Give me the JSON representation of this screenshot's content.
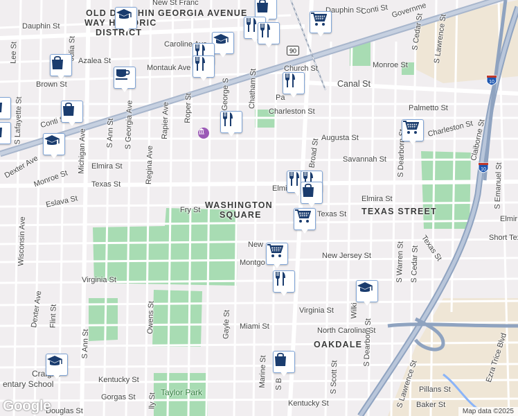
{
  "neighborhoods": {
    "old_dauphin_line1": "OLD DAUPHIN",
    "georgia_avenue": "GEORGIA AVENUE",
    "old_dauphin_line2": "WAY HISTORIC",
    "district": "DISTRICT",
    "washington_square_1": "WASHINGTON",
    "washington_square_2": "SQUARE",
    "texas_street": "TEXAS STREET",
    "oakdale": "OAKDALE"
  },
  "streets": {
    "new_st_francis": "New St Franc",
    "dauphin_st_top": "Dauphin St",
    "dauphin_st_left": "Dauphin St",
    "conti_st_top": "Conti St",
    "government": "Governme",
    "julia_st": "Julia St",
    "lee_st": "Lee St",
    "caroline_ave": "Caroline Ave",
    "azalea_st": "Azalea St",
    "montauk_ave": "Montauk Ave",
    "brown_st": "Brown St",
    "conti_st_left": "Conti St",
    "s_lafayette_st": "S Lafayette St",
    "michigan_ave": "Michigan Ave",
    "s_ann_st": "S Ann St",
    "s_georgia_ave": "S Georgia Ave",
    "rapier_ave": "Rapier Ave",
    "roper_st": "Roper St",
    "george_st": "George S",
    "chatham_st": "Chatham St",
    "church_st": "Church St",
    "pa_st": "Pa",
    "charleston_st": "Charleston St",
    "canal_st": "Canal St",
    "monroe_st_right": "Monroe St",
    "s_cedar_st_top": "S Cedar St",
    "s_lawrence_st_top": "S Lawrence St",
    "palmetto_st": "Palmetto St",
    "charleston_st_right": "Charleston St",
    "augusta_st": "Augusta St",
    "savannah_st": "Savannah St",
    "broad_st": "Broad St",
    "s_dearborn_st_top": "S Dearborn St",
    "claiborne_st": "Claiborne St",
    "regina_ave": "Regina Ave",
    "elmira_st_left": "Elmira St",
    "dexter_ave_top": "Dexter Ave",
    "monroe_st_left": "Monroe St",
    "texas_st_left": "Texas St",
    "eslava_st": "Eslava St",
    "fry_st": "Fry St",
    "elmira_st_mid": "Elmi",
    "elmira_st_right": "Elmira St",
    "texas_st_right": "Texas St",
    "s_emanuel_st": "S Emanuel St",
    "elmir_edge": "Elmir",
    "short_texas": "Short Tex",
    "wisconsin_ave": "Wisconsin Ave",
    "new_st": "New",
    "new_jersey_st": "New Jersey St",
    "montgomery_st": "Montgo",
    "s_warren_st": "S Warren St",
    "s_cedar_st": "S Cedar St",
    "texas_st_diag": "Texas St",
    "virginia_st_left": "Virginia St",
    "virginia_st_right": "Virginia St",
    "dexter_ave": "Dexter Ave",
    "flint_st": "Flint St",
    "owens_st": "Owens St",
    "gayle_st": "Gayle St",
    "miami_st": "Miami St",
    "north_carolina_st": "North Carolina St",
    "wilkinson_st": "Wilki",
    "s_dearborn_st": "S Dearborn St",
    "ezra_trice_blvd": "Ezra Trice Blvd",
    "s_ann_st_bottom": "S Ann St",
    "marine_st": "Marine St",
    "s_broad_st": "S B",
    "s_scott_st": "S Scott St",
    "s_lawrence_st": "S Lawrence St",
    "pillans_st": "Pillans St",
    "kentucky_st_left": "Kentucky St",
    "kentucky_st_right": "Kentucky St",
    "gorgas_st": "Gorgas St",
    "douglas_st": "Douglas St",
    "baker_st": "Baker St",
    "lly_st": "lly St"
  },
  "places": {
    "craighead_1": "Craighe",
    "craighead_2": "entary School",
    "taylor_park": "Taylor Park"
  },
  "route_shields": {
    "us90": "90",
    "i10_a": "10",
    "i10_b": "10"
  },
  "poi_pins": [
    {
      "icon": "school-icon"
    },
    {
      "icon": "shopping-bag-icon"
    },
    {
      "icon": "shopping-cart-icon"
    },
    {
      "icon": "restaurant-icon"
    },
    {
      "icon": "restaurant-icon"
    },
    {
      "icon": "school-icon"
    },
    {
      "icon": "restaurant-icon"
    },
    {
      "icon": "restaurant-icon"
    },
    {
      "icon": "shopping-bag-icon"
    },
    {
      "icon": "cafe-icon"
    },
    {
      "icon": "restaurant-icon"
    },
    {
      "icon": "shopping-bag-icon"
    },
    {
      "icon": "school-icon"
    },
    {
      "icon": "restaurant-icon"
    },
    {
      "icon": "shopping-cart-icon"
    },
    {
      "icon": "restaurant-icon"
    },
    {
      "icon": "restaurant-icon"
    },
    {
      "icon": "shopping-bag-icon"
    },
    {
      "icon": "shopping-cart-icon"
    },
    {
      "icon": "shopping-cart-icon"
    },
    {
      "icon": "restaurant-icon"
    },
    {
      "icon": "school-icon"
    },
    {
      "icon": "school-icon"
    },
    {
      "icon": "shopping-bag-icon"
    }
  ],
  "colors": {
    "park": "#a8dcb3",
    "road": "#ffffff",
    "highway": "#8fa3c0",
    "pin_icon": "#1a3c6e",
    "background": "#f1eef0"
  },
  "attribution": {
    "google": "Google",
    "map_data": "Map data ©2025"
  }
}
